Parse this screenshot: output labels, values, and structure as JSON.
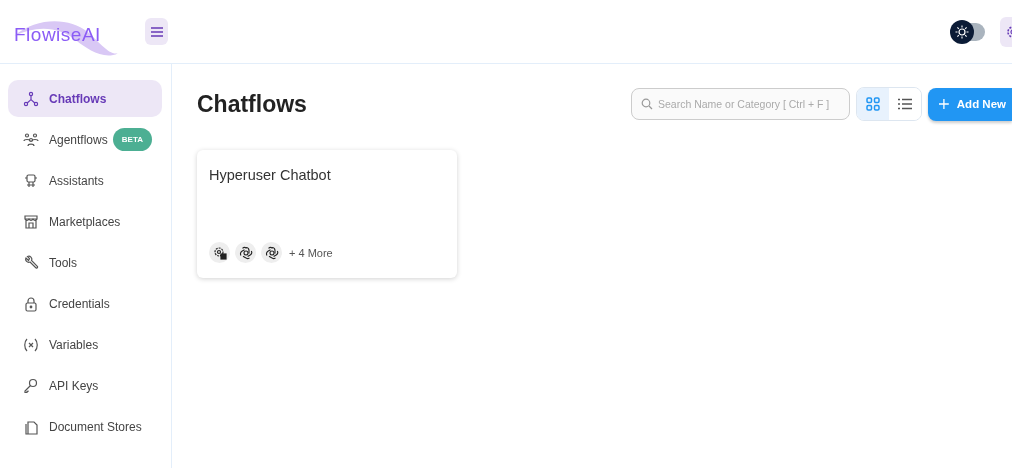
{
  "header": {
    "logo": "FlowiseAI",
    "theme_toggle": {
      "on": false
    }
  },
  "sidebar": {
    "items": [
      {
        "label": "Chatflows",
        "selected": true
      },
      {
        "label": "Agentflows",
        "selected": false,
        "badge": "BETA"
      },
      {
        "label": "Assistants",
        "selected": false
      },
      {
        "label": "Marketplaces",
        "selected": false
      },
      {
        "label": "Tools",
        "selected": false
      },
      {
        "label": "Credentials",
        "selected": false
      },
      {
        "label": "Variables",
        "selected": false
      },
      {
        "label": "API Keys",
        "selected": false
      },
      {
        "label": "Document Stores",
        "selected": false
      }
    ]
  },
  "page": {
    "title": "Chatflows",
    "search": {
      "placeholder": "Search Name or Category [ Ctrl + F ]"
    },
    "views": [
      {
        "kind": "grid",
        "selected": true
      },
      {
        "kind": "list",
        "selected": false
      }
    ],
    "add_button": "Add New"
  },
  "cards": [
    {
      "title": "Hyperuser Chatbot",
      "nodes": [
        {
          "kind": "tool"
        },
        {
          "kind": "openai"
        },
        {
          "kind": "openai"
        }
      ],
      "more": "+ 4 More"
    }
  ]
}
